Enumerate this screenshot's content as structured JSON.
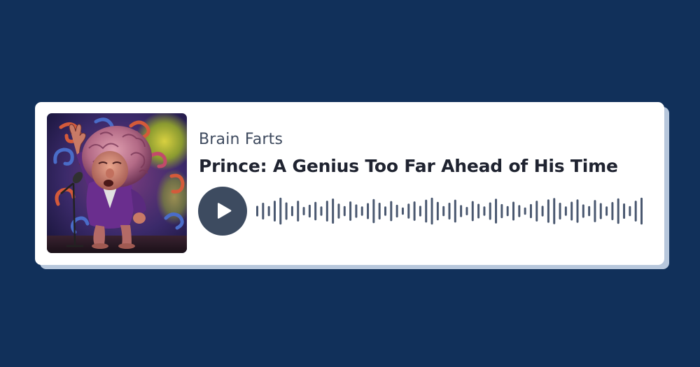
{
  "player": {
    "show_name": "Brain Farts",
    "episode_title": "Prince: A Genius Too Far Ahead of His Time",
    "artwork_alt": "Brain Farts",
    "state": "paused",
    "progress": 0
  },
  "icons": {
    "play": "play-icon"
  },
  "colors": {
    "background": "#11305a",
    "card": "#ffffff",
    "card_shadow": "#b7c7dc",
    "play_button": "#3d4b60",
    "waveform": "#4a5870",
    "show_name": "#3e4a5e",
    "title": "#1f2330"
  },
  "waveform_levels": [
    0.32,
    0.5,
    0.3,
    0.62,
    0.8,
    0.52,
    0.3,
    0.62,
    0.25,
    0.38,
    0.55,
    0.28,
    0.62,
    0.75,
    0.45,
    0.3,
    0.58,
    0.4,
    0.28,
    0.48,
    0.72,
    0.5,
    0.28,
    0.6,
    0.38,
    0.22,
    0.45,
    0.58,
    0.32,
    0.68,
    0.8,
    0.55,
    0.3,
    0.5,
    0.68,
    0.36,
    0.25,
    0.6,
    0.44,
    0.28,
    0.52,
    0.74,
    0.42,
    0.3,
    0.56,
    0.36,
    0.22,
    0.42,
    0.62,
    0.32,
    0.7,
    0.78,
    0.5,
    0.28,
    0.56,
    0.7,
    0.4,
    0.3,
    0.66,
    0.48,
    0.28,
    0.54,
    0.76,
    0.46,
    0.3,
    0.62,
    0.8
  ]
}
